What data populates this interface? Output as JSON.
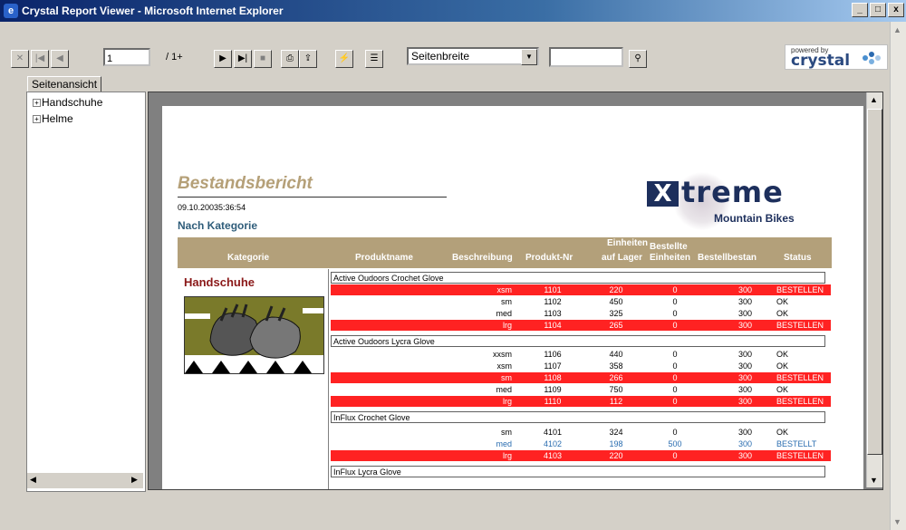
{
  "window": {
    "title": "Crystal Report Viewer - Microsoft Internet Explorer",
    "controls": [
      "_",
      "□",
      "x"
    ]
  },
  "toolbar": {
    "page_input": "1",
    "page_count": "/ 1+",
    "zoom_selected": "Seitenbreite",
    "search_value": "",
    "powered_by": "powered by",
    "brand": "crystal"
  },
  "tab": {
    "label": "Seitenansicht"
  },
  "group_tree": {
    "items": [
      {
        "label": "Handschuhe"
      },
      {
        "label": "Helme"
      }
    ]
  },
  "report": {
    "title": "Bestandsbericht",
    "date": "09.10.20035:36:54",
    "subtitle": "Nach Kategorie",
    "logo": {
      "brand_x": "X",
      "brand_rest": "treme",
      "tagline": "Mountain Bikes"
    },
    "headers": {
      "kategorie": "Kategorie",
      "produktname": "Produktname",
      "beschreibung": "Beschreibung",
      "produkt_nr": "Produkt-Nr",
      "einheiten_lager": [
        "Einheiten",
        "auf Lager"
      ],
      "bestellte": [
        "Bestellte",
        "Einheiten"
      ],
      "bestellbestand": "Bestellbestan",
      "status": "Status"
    },
    "category": "Handschuhe",
    "groups": [
      {
        "product": "Active Oudoors Crochet Glove",
        "rows": [
          {
            "desc": "xsm",
            "nr": "1101",
            "lager": "220",
            "best": "0",
            "bestd": "300",
            "status": "BESTELLEN",
            "style": "red"
          },
          {
            "desc": "sm",
            "nr": "1102",
            "lager": "450",
            "best": "0",
            "bestd": "300",
            "status": "OK",
            "style": ""
          },
          {
            "desc": "med",
            "nr": "1103",
            "lager": "325",
            "best": "0",
            "bestd": "300",
            "status": "OK",
            "style": ""
          },
          {
            "desc": "lrg",
            "nr": "1104",
            "lager": "265",
            "best": "0",
            "bestd": "300",
            "status": "BESTELLEN",
            "style": "red"
          }
        ]
      },
      {
        "product": "Active Oudoors Lycra Glove",
        "rows": [
          {
            "desc": "xxsm",
            "nr": "1106",
            "lager": "440",
            "best": "0",
            "bestd": "300",
            "status": "OK",
            "style": ""
          },
          {
            "desc": "xsm",
            "nr": "1107",
            "lager": "358",
            "best": "0",
            "bestd": "300",
            "status": "OK",
            "style": ""
          },
          {
            "desc": "sm",
            "nr": "1108",
            "lager": "266",
            "best": "0",
            "bestd": "300",
            "status": "BESTELLEN",
            "style": "red"
          },
          {
            "desc": "med",
            "nr": "1109",
            "lager": "750",
            "best": "0",
            "bestd": "300",
            "status": "OK",
            "style": ""
          },
          {
            "desc": "lrg",
            "nr": "1110",
            "lager": "112",
            "best": "0",
            "bestd": "300",
            "status": "BESTELLEN",
            "style": "red"
          }
        ]
      },
      {
        "product": "InFlux Crochet Glove",
        "rows": [
          {
            "desc": "sm",
            "nr": "4101",
            "lager": "324",
            "best": "0",
            "bestd": "300",
            "status": "OK",
            "style": ""
          },
          {
            "desc": "med",
            "nr": "4102",
            "lager": "198",
            "best": "500",
            "bestd": "300",
            "status": "BESTELLT",
            "style": "blue"
          },
          {
            "desc": "lrg",
            "nr": "4103",
            "lager": "220",
            "best": "0",
            "bestd": "300",
            "status": "BESTELLEN",
            "style": "red"
          }
        ]
      },
      {
        "product": "InFlux Lycra Glove",
        "rows": []
      }
    ]
  },
  "colors": {
    "accent_band": "#b3a07a",
    "title": "#b5a078",
    "subtitle": "#2f5d7a",
    "category": "#8a1818",
    "alert_row": "#ff2222",
    "ordered_text": "#2a6db0"
  }
}
